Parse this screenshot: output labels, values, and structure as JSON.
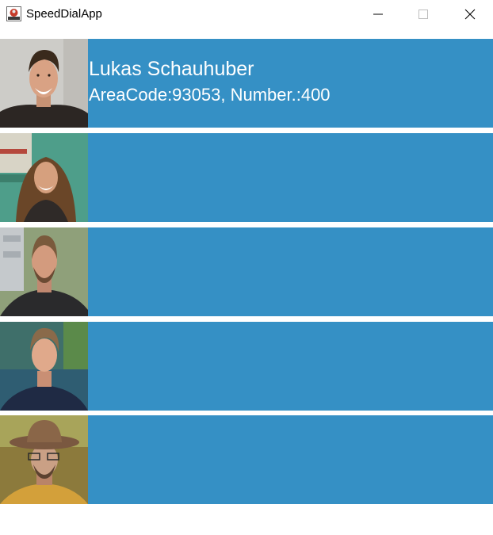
{
  "window": {
    "title": "SpeedDialApp",
    "icon": "java-app-icon",
    "controls": [
      "minimize-icon",
      "maximize-icon",
      "close-icon"
    ]
  },
  "contacts": [
    {
      "name": "Lukas Schauhuber",
      "detail": "AreaCode:93053, Number.:400",
      "photo": "avatar-man-smiling"
    },
    {
      "name": "",
      "detail": "",
      "photo": "avatar-woman-long-hair"
    },
    {
      "name": "",
      "detail": "",
      "photo": "avatar-man-beard"
    },
    {
      "name": "",
      "detail": "",
      "photo": "avatar-man-outdoor"
    },
    {
      "name": "",
      "detail": "",
      "photo": "avatar-man-hat"
    }
  ],
  "colors": {
    "panel": "#3590c5",
    "text": "#ffffff"
  }
}
